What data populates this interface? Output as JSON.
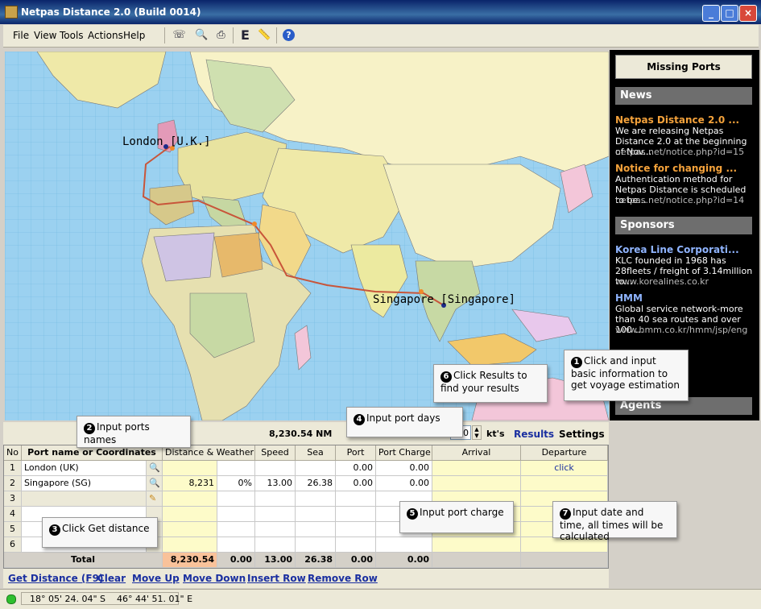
{
  "window": {
    "title": "Netpas Distance 2.0 (Build 0014)"
  },
  "menu": [
    "File",
    "View",
    "Tools",
    "Actions",
    "Help"
  ],
  "toolbar_icons": [
    "fax-icon",
    "search-doc-icon",
    "print-icon",
    "e-icon",
    "ruler-icon",
    "help-icon"
  ],
  "toolbar_e_label": "E",
  "map": {
    "labels": {
      "london": "London [U.K.]",
      "singapore": "Singapore [Singapore]"
    }
  },
  "right_panel": {
    "missing_ports": "Missing Ports",
    "news_header": "News",
    "news": [
      {
        "title": "Netpas Distance 2.0 ...",
        "body": "We are releasing Netpas Distance 2.0 at the beginning of Nov...",
        "link": "netpas.net/notice.php?id=15"
      },
      {
        "title": "Notice for changing ...",
        "body": "Authentication method for Netpas Distance is scheduled to be...",
        "link": "netpas.net/notice.php?id=14"
      }
    ],
    "sponsors_header": "Sponsors",
    "sponsors": [
      {
        "title": "Korea Line Corporati...",
        "body": "KLC founded in 1968 has 28fleets / freight of 3.14million to...",
        "link": "www.korealines.co.kr"
      },
      {
        "title": "HMM",
        "body": "Global service network-more than 40 sea routes and over 100 ...",
        "link": "www.hmm.co.kr/hmm/jsp/eng"
      }
    ],
    "agents_header": "Agents"
  },
  "distbar": {
    "total_nm": "8,230.54 NM",
    "speed_value": "0",
    "speed_unit": "kt's",
    "results": "Results",
    "settings": "Settings"
  },
  "grid": {
    "headers": [
      "No",
      "Port name or Coordinates",
      "Distance & Weather",
      "Speed",
      "Sea",
      "Port",
      "Port Charge",
      "Arrival",
      "Departure"
    ],
    "rows": [
      {
        "no": "1",
        "port": "London (UK)",
        "distance": "",
        "weather": "",
        "speed": "",
        "sea": "",
        "port_days": "0.00",
        "charge": "0.00",
        "arrival": "",
        "departure": "click"
      },
      {
        "no": "2",
        "port": "Singapore (SG)",
        "distance": "8,231",
        "weather": "0%",
        "speed": "13.00",
        "sea": "26.38",
        "port_days": "0.00",
        "charge": "0.00",
        "arrival": "",
        "departure": ""
      },
      {
        "no": "3",
        "port": "",
        "distance": "",
        "weather": "",
        "speed": "",
        "sea": "",
        "port_days": "",
        "charge": "",
        "arrival": "",
        "departure": ""
      },
      {
        "no": "4",
        "port": "",
        "distance": "",
        "weather": "",
        "speed": "",
        "sea": "",
        "port_days": "",
        "charge": "",
        "arrival": "",
        "departure": ""
      },
      {
        "no": "5",
        "port": "",
        "distance": "",
        "weather": "",
        "speed": "",
        "sea": "",
        "port_days": "",
        "charge": "",
        "arrival": "",
        "departure": ""
      },
      {
        "no": "6",
        "port": "",
        "distance": "",
        "weather": "",
        "speed": "",
        "sea": "",
        "port_days": "",
        "charge": "",
        "arrival": "",
        "departure": ""
      }
    ],
    "total": {
      "label": "Total",
      "distance": "8,230.54",
      "weather": "0.00",
      "speed": "13.00",
      "sea": "26.38",
      "port": "0.00",
      "charge": "0.00"
    }
  },
  "links": [
    "Get Distance (F9)",
    "Clear",
    "Move Up",
    "Move Down",
    "Insert Row",
    "Remove Row"
  ],
  "status": {
    "coords": "18° 05' 24. 04\" S    46° 44' 51. 01\" E"
  },
  "callouts": {
    "c1": {
      "num": "1",
      "text": "Click and input basic information to get voyage estimation"
    },
    "c2": {
      "num": "2",
      "text": "Input ports names"
    },
    "c3": {
      "num": "3",
      "text": "Click Get distance"
    },
    "c4": {
      "num": "4",
      "text": "Input port days"
    },
    "c5": {
      "num": "5",
      "text": "Input port charge"
    },
    "c6": {
      "num": "6",
      "text": "Click Results to find your results"
    },
    "c7": {
      "num": "7",
      "text": "Input date and time, all times will be calculated"
    }
  },
  "colors": {
    "sea": "#9bd1f0",
    "route": "#c8553a",
    "news_title": "#f4a23b",
    "sponsor_title": "#8fb4ff",
    "link": "#1a2fa0"
  }
}
